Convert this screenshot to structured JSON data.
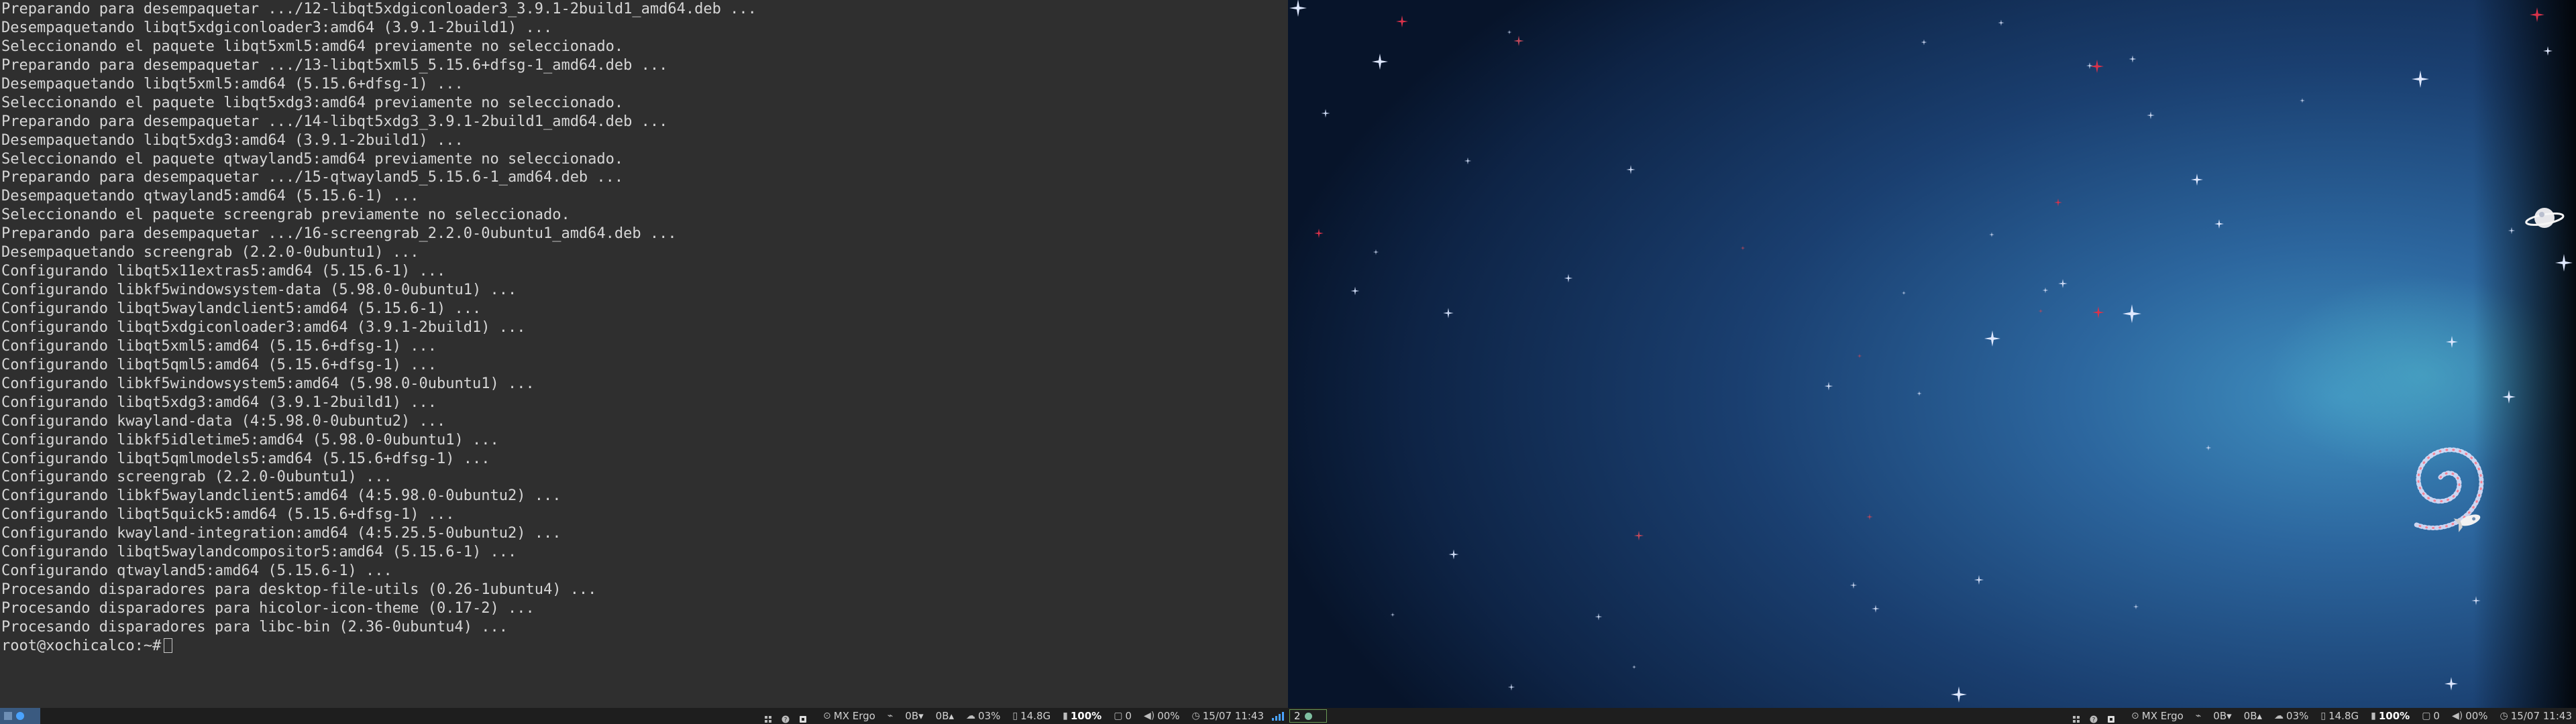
{
  "terminal": {
    "lines": [
      "Preparando para desempaquetar .../12-libqt5xdgiconloader3_3.9.1-2build1_amd64.deb ...",
      "Desempaquetando libqt5xdgiconloader3:amd64 (3.9.1-2build1) ...",
      "Seleccionando el paquete libqt5xml5:amd64 previamente no seleccionado.",
      "Preparando para desempaquetar .../13-libqt5xml5_5.15.6+dfsg-1_amd64.deb ...",
      "Desempaquetando libqt5xml5:amd64 (5.15.6+dfsg-1) ...",
      "Seleccionando el paquete libqt5xdg3:amd64 previamente no seleccionado.",
      "Preparando para desempaquetar .../14-libqt5xdg3_3.9.1-2build1_amd64.deb ...",
      "Desempaquetando libqt5xdg3:amd64 (3.9.1-2build1) ...",
      "Seleccionando el paquete qtwayland5:amd64 previamente no seleccionado.",
      "Preparando para desempaquetar .../15-qtwayland5_5.15.6-1_amd64.deb ...",
      "Desempaquetando qtwayland5:amd64 (5.15.6-1) ...",
      "Seleccionando el paquete screengrab previamente no seleccionado.",
      "Preparando para desempaquetar .../16-screengrab_2.2.0-0ubuntu1_amd64.deb ...",
      "Desempaquetando screengrab (2.2.0-0ubuntu1) ...",
      "Configurando libqt5x11extras5:amd64 (5.15.6-1) ...",
      "Configurando libkf5windowsystem-data (5.98.0-0ubuntu1) ...",
      "Configurando libqt5waylandclient5:amd64 (5.15.6-1) ...",
      "Configurando libqt5xdgiconloader3:amd64 (3.9.1-2build1) ...",
      "Configurando libqt5xml5:amd64 (5.15.6+dfsg-1) ...",
      "Configurando libqt5qml5:amd64 (5.15.6+dfsg-1) ...",
      "Configurando libkf5windowsystem5:amd64 (5.98.0-0ubuntu1) ...",
      "Configurando libqt5xdg3:amd64 (3.9.1-2build1) ...",
      "Configurando kwayland-data (4:5.98.0-0ubuntu2) ...",
      "Configurando libkf5idletime5:amd64 (5.98.0-0ubuntu1) ...",
      "Configurando libqt5qmlmodels5:amd64 (5.15.6+dfsg-1) ...",
      "Configurando screengrab (2.2.0-0ubuntu1) ...",
      "Configurando libkf5waylandclient5:amd64 (4:5.98.0-0ubuntu2) ...",
      "Configurando libqt5quick5:amd64 (5.15.6+dfsg-1) ...",
      "Configurando kwayland-integration:amd64 (4:5.25.5-0ubuntu2) ...",
      "Configurando libqt5waylandcompositor5:amd64 (5.15.6-1) ...",
      "Configurando qtwayland5:amd64 (5.15.6-1) ...",
      "Procesando disparadores para desktop-file-utils (0.26-1ubuntu4) ...",
      "Procesando disparadores para hicolor-icon-theme (0.17-2) ...",
      "Procesando disparadores para libc-bin (2.36-0ubuntu4) ..."
    ],
    "prompt": "root@xochicalco:~#"
  },
  "bar_left": {
    "workspace_icon": "workspace-indicator-icon",
    "modules": {
      "keyboard": "MX Ergo",
      "wifi": "0B▾",
      "upload": "0B▴",
      "weather": "03%",
      "disk": "14.8G",
      "battery": "100%",
      "notifications": "0",
      "volume": "00%",
      "clock": "15/07 11:43"
    }
  },
  "bar_right": {
    "workspace_number": "2",
    "modules": {
      "keyboard": "MX Ergo",
      "wifi": "0B▾",
      "upload": "0B▴",
      "weather": "03%",
      "disk": "14.8G",
      "battery": "100%",
      "notifications": "0",
      "volume": "00%",
      "clock": "15/07 11:43"
    }
  },
  "colors": {
    "terminal_bg": "#2f2f2f",
    "terminal_fg": "#d6d6d6",
    "bar_bg": "#1e1e1e",
    "accent_blue": "#4aa3ff",
    "wallpaper_deep": "#0b1830",
    "wallpaper_glow": "#3a86b5"
  }
}
